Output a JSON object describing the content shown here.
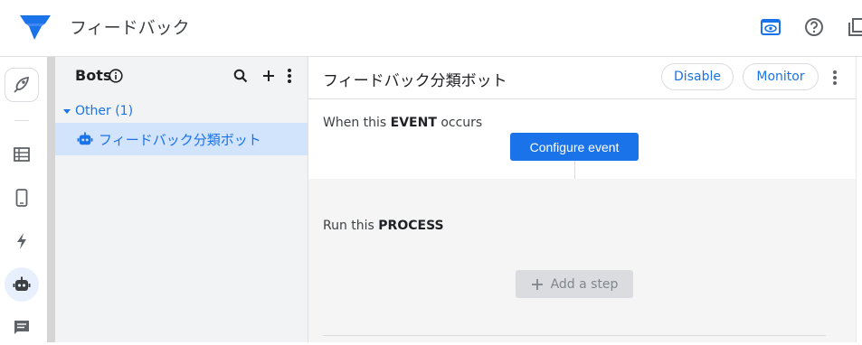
{
  "app": {
    "title": "フィードバック"
  },
  "colors": {
    "accent": "#1a73e8",
    "selected_row": "#d2e3fc",
    "panel_bg": "#f1f3f4",
    "process_bg": "#f5f5f5"
  },
  "top_actions": {
    "icons": [
      "preview-eye-icon",
      "help-icon",
      "copy-icon"
    ]
  },
  "rail": {
    "icons": [
      "rocket-icon",
      "table-icon",
      "phone-icon",
      "bolt-icon",
      "robot-icon",
      "chat-icon"
    ],
    "active": "robot-icon"
  },
  "bots_panel": {
    "title": "Bots",
    "group_label": "Other (1)",
    "items": [
      {
        "label": "フィードバック分類ボット",
        "selected": true
      }
    ]
  },
  "main": {
    "bot_title": "フィードバック分類ボット",
    "disable_label": "Disable",
    "monitor_label": "Monitor",
    "event_prefix": "When this ",
    "event_keyword": "EVENT",
    "event_suffix": " occurs",
    "configure_event_label": "Configure event",
    "process_prefix": "Run this ",
    "process_keyword": "PROCESS",
    "add_step_label": "Add a step"
  }
}
